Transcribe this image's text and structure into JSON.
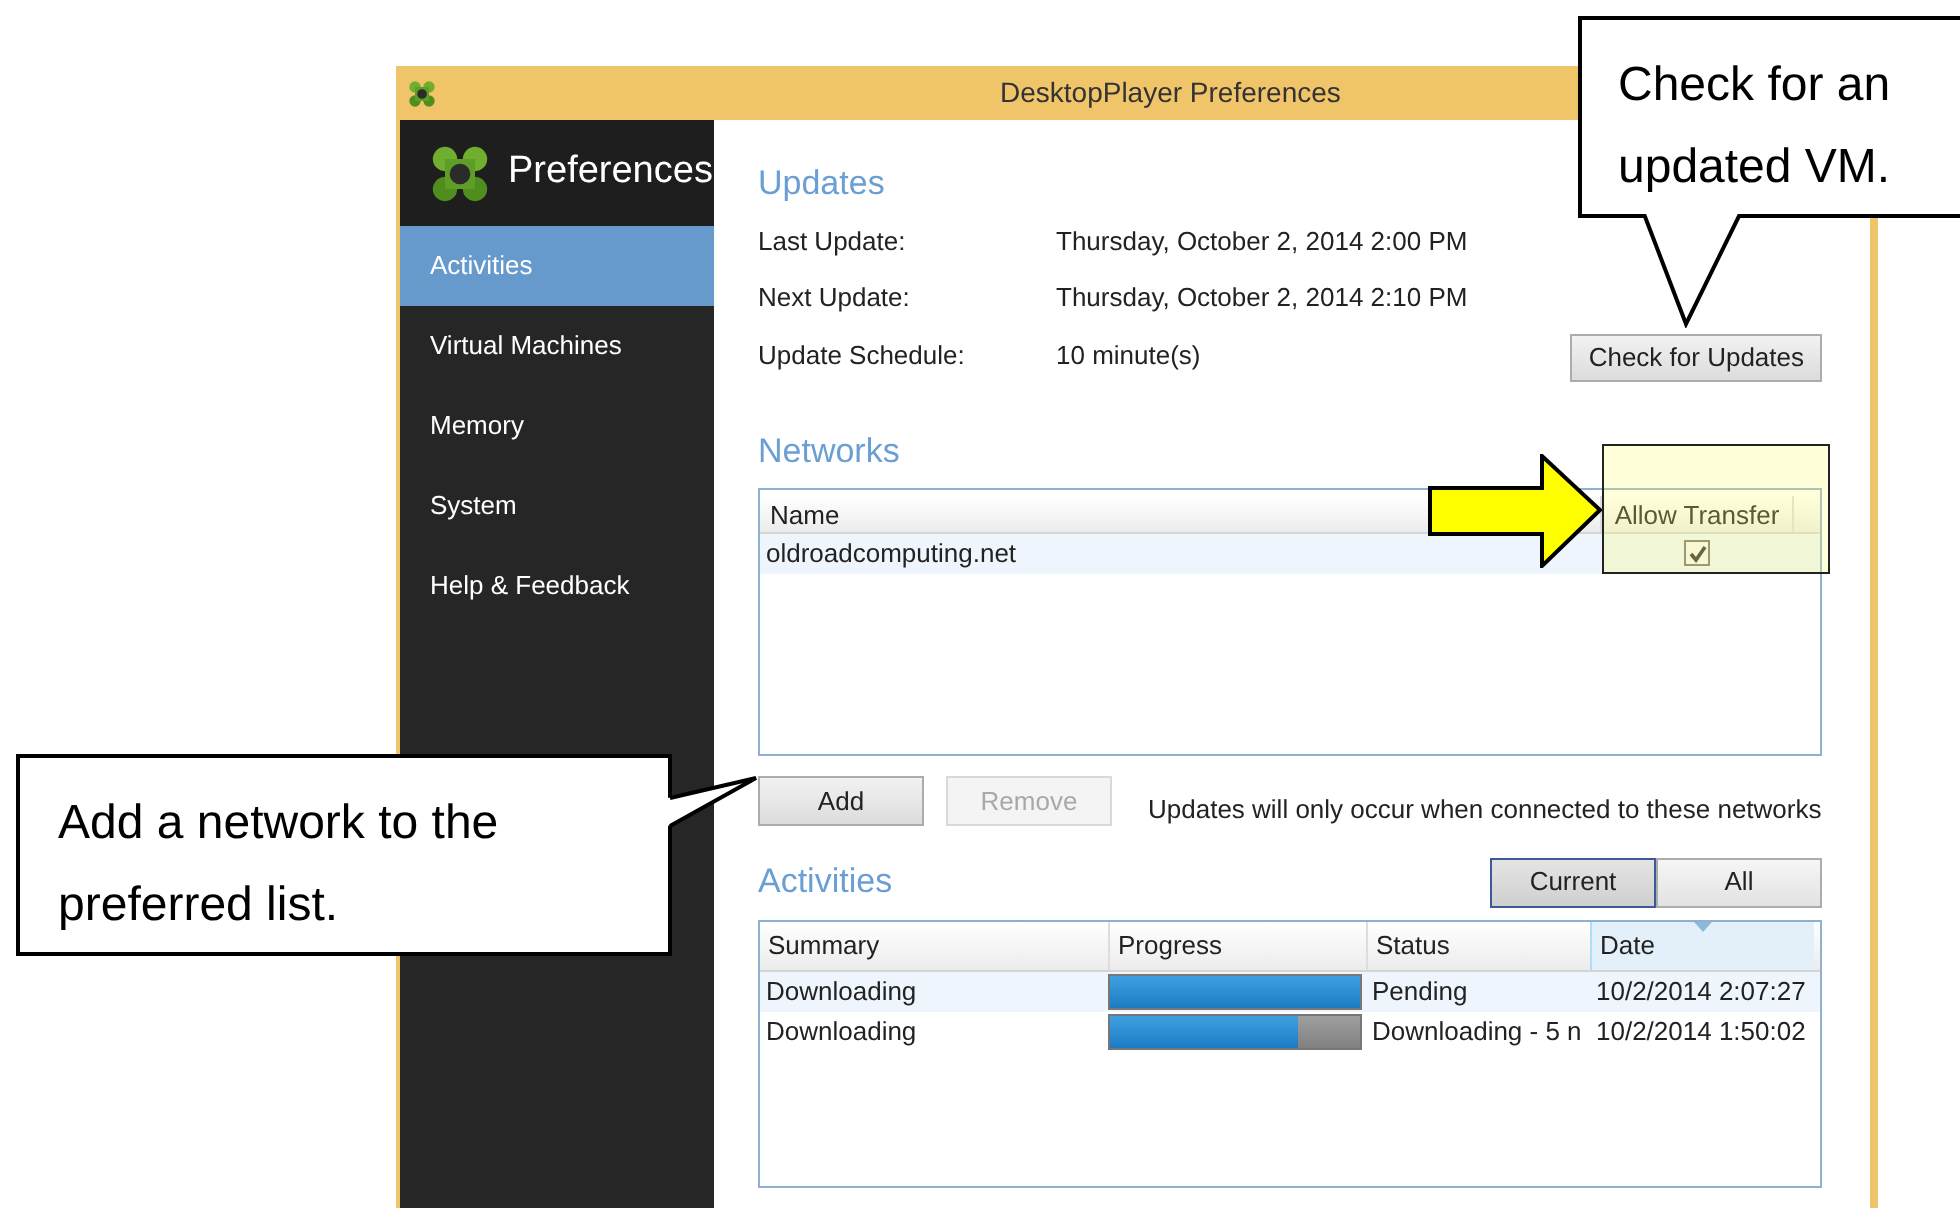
{
  "window": {
    "title": "DesktopPlayer Preferences"
  },
  "sidebar": {
    "title": "Preferences",
    "items": [
      {
        "label": "Activities",
        "selected": true
      },
      {
        "label": "Virtual Machines",
        "selected": false
      },
      {
        "label": "Memory",
        "selected": false
      },
      {
        "label": "System",
        "selected": false
      },
      {
        "label": "Help & Feedback",
        "selected": false
      }
    ]
  },
  "updates": {
    "heading": "Updates",
    "rows": [
      {
        "label": "Last Update:",
        "value": "Thursday, October 2, 2014 2:00 PM"
      },
      {
        "label": "Next Update:",
        "value": "Thursday, October 2, 2014 2:10 PM"
      },
      {
        "label": "Update Schedule:",
        "value": "10 minute(s)"
      }
    ],
    "button": "Check for Updates"
  },
  "networks": {
    "heading": "Networks",
    "columns": [
      "Name",
      "Allow Transfer"
    ],
    "rows": [
      {
        "name": "oldroadcomputing.net",
        "allow_transfer": true
      }
    ],
    "buttons": [
      {
        "label": "Add",
        "disabled": false
      },
      {
        "label": "Remove",
        "disabled": true
      }
    ],
    "note": "Updates will only occur when connected to these networks"
  },
  "activities": {
    "heading": "Activities",
    "filters": [
      {
        "label": "Current",
        "selected": true
      },
      {
        "label": "All",
        "selected": false
      }
    ],
    "columns": [
      "Summary",
      "Progress",
      "Status",
      "Date"
    ],
    "rows": [
      {
        "summary": "Downloading",
        "level": 1,
        "status": "Pending",
        "date": "10/2/2014 2:07:27"
      },
      {
        "summary": "Downloading",
        "level": 0.75,
        "status": "Downloading - 5 n",
        "date": "10/2/2014 1:50:02"
      }
    ]
  },
  "callouts": [
    {
      "text": "Check for an updated VM."
    },
    {
      "text": "Add a network to the preferred list."
    }
  ]
}
